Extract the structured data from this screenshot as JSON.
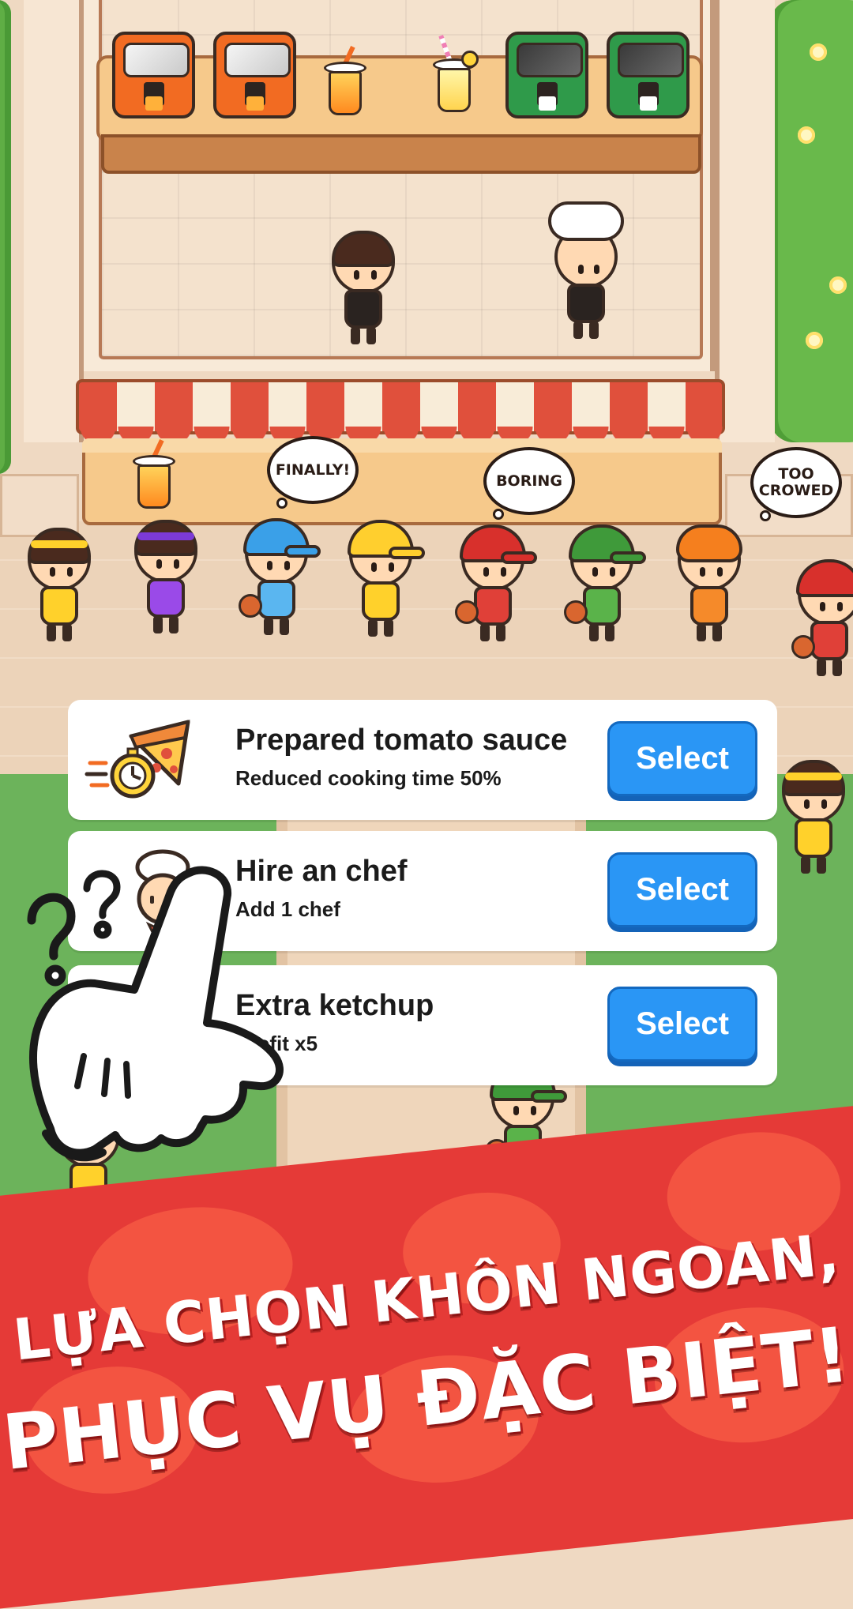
{
  "speech_bubbles": {
    "finally": "FINALLY!",
    "boring": "BORING",
    "too_crowed_line1": "TOO",
    "too_crowed_line2": "CROWED"
  },
  "upgrade_cards": [
    {
      "title": "Prepared tomato sauce",
      "subtitle": "Reduced cooking time 50%",
      "button": "Select",
      "icon": "pizza-stopwatch-icon"
    },
    {
      "title": "Hire an chef",
      "subtitle": "Add 1 chef",
      "button": "Select",
      "icon": "chef-icon"
    },
    {
      "title": "Extra ketchup",
      "subtitle": "Profit x5",
      "button": "Select",
      "icon": "ketchup-icon"
    }
  ],
  "banner": {
    "line1": "LỰA CHỌN KHÔN NGOAN,",
    "line2": "PHỤC VỤ ĐẶC BIỆT!"
  },
  "colors": {
    "select_button": "#2a96f5",
    "banner_red": "#e53a37",
    "awning_red": "#e0503c",
    "grass": "#6cb35b"
  }
}
